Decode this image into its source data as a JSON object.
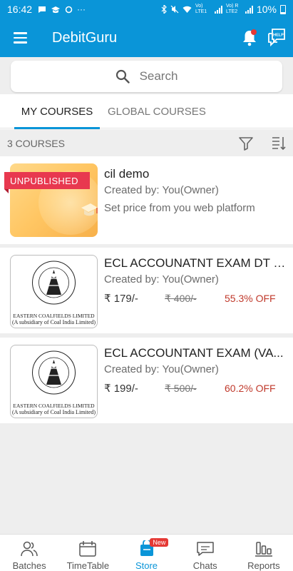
{
  "status_bar": {
    "time": "16:42",
    "dots": "···",
    "battery": "10%",
    "lte1": "Vo) LTE1",
    "lte2": "Vo) R LTE2"
  },
  "app": {
    "title": "DebitGuru",
    "help_label": "HELP"
  },
  "search": {
    "placeholder": "Search"
  },
  "tabs": [
    {
      "label": "MY COURSES",
      "active": true
    },
    {
      "label": "GLOBAL COURSES",
      "active": false
    }
  ],
  "courses_count": "3 COURSES",
  "courses": [
    {
      "title": "cil demo",
      "created_by": "Created by: You(Owner)",
      "note": "Set price from you web platform",
      "badge": "UNPUBLISHED"
    },
    {
      "title": "ECL ACCOUNATNT EXAM DT r...",
      "created_by": "Created by: You(Owner)",
      "price": "₹ 179/-",
      "original_price": "₹ 400/-",
      "discount": "55.3% OFF",
      "logo_line1": "EASTERN COALFIELDS LIMITED",
      "logo_line2": "(A subsidiary of Coal India Limited)"
    },
    {
      "title": "ECL ACCOUNTANT EXAM (VA...",
      "created_by": "Created by: You(Owner)",
      "price": "₹ 199/-",
      "original_price": "₹ 500/-",
      "discount": "60.2% OFF",
      "logo_line1": "EASTERN COALFIELDS LIMITED",
      "logo_line2": "(A subsidiary of Coal India Limited)"
    }
  ],
  "bottom_nav": [
    {
      "label": "Batches",
      "icon": "people-icon"
    },
    {
      "label": "TimeTable",
      "icon": "calendar-icon"
    },
    {
      "label": "Store",
      "icon": "store-icon",
      "badge": "New",
      "active": true
    },
    {
      "label": "Chats",
      "icon": "chat-icon"
    },
    {
      "label": "Reports",
      "icon": "reports-icon"
    }
  ],
  "colors": {
    "primary": "#0a95d8",
    "badge_red": "#e8384f",
    "discount_red": "#c0392b"
  }
}
